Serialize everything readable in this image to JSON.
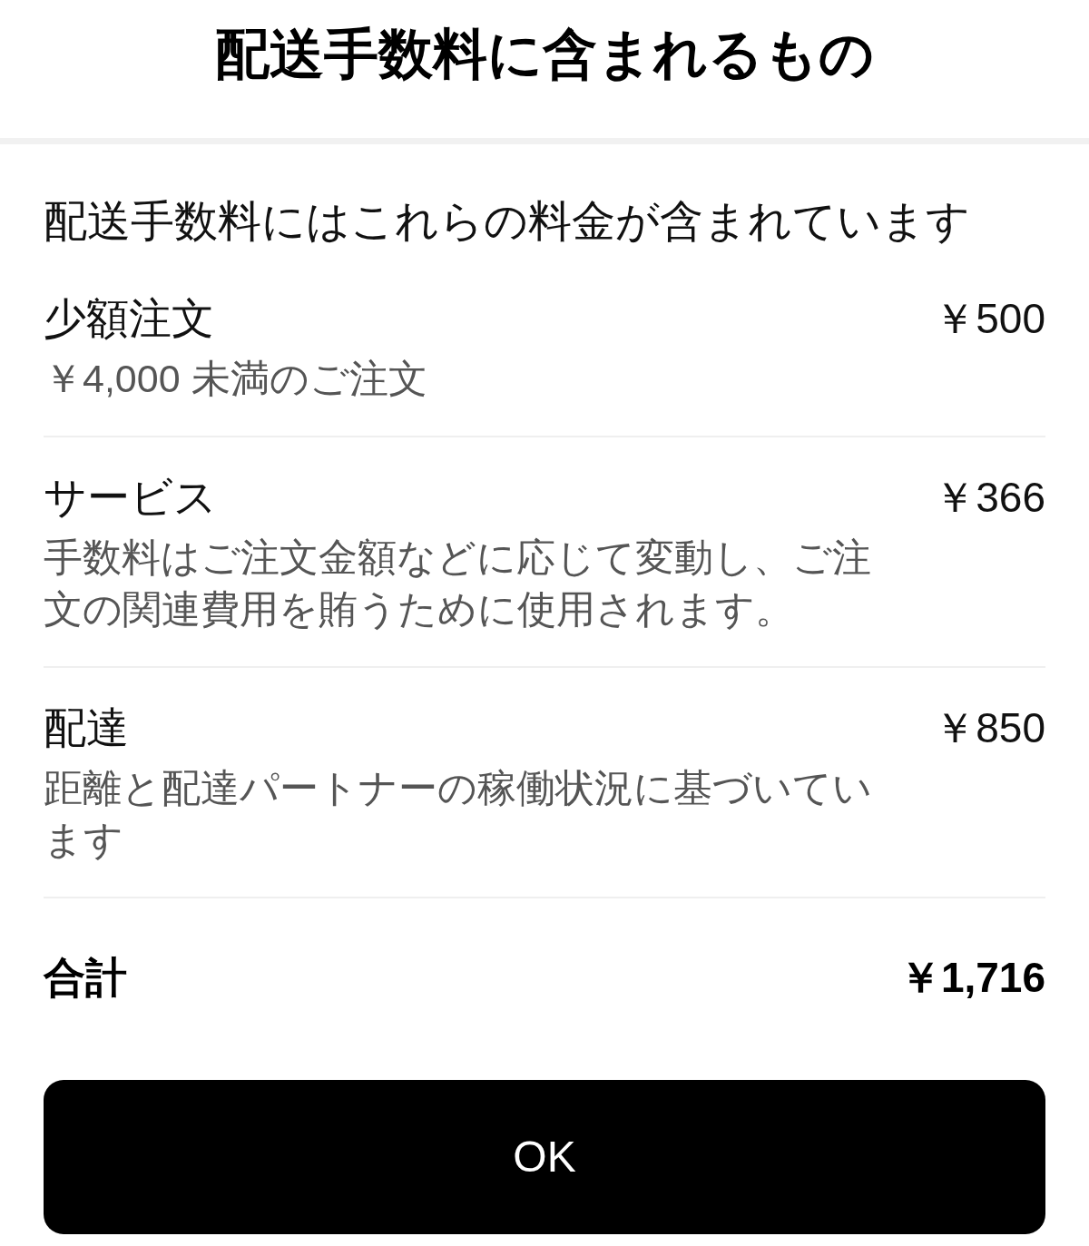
{
  "header": {
    "title": "配送手数料に含まれるもの"
  },
  "intro": "配送手数料にはこれらの料金が含まれています",
  "fees": [
    {
      "name": "少額注文",
      "price": "￥500",
      "description": "￥4,000 未満のご注文"
    },
    {
      "name": "サービス",
      "price": "￥366",
      "description": "手数料はご注文金額などに応じて変動し、ご注文の関連費用を賄うために使用されます。"
    },
    {
      "name": "配達",
      "price": "￥850",
      "description": "距離と配達パートナーの稼働状況に基づいています"
    }
  ],
  "total": {
    "label": "合計",
    "amount": "￥1,716"
  },
  "button": {
    "label": "OK"
  }
}
